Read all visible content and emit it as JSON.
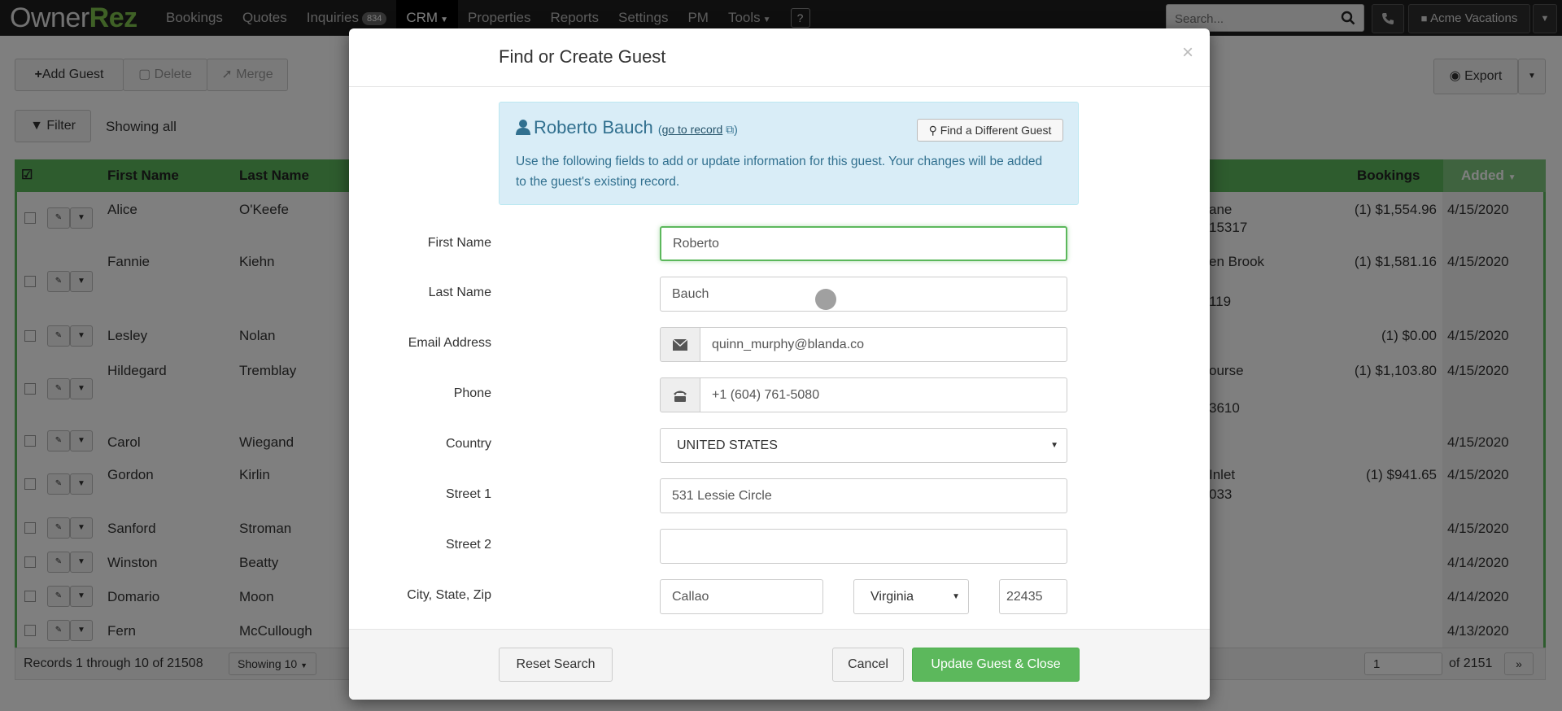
{
  "nav": {
    "logo_owner": "Owner",
    "logo_rez": "Rez",
    "items": [
      "Bookings",
      "Quotes",
      "Inquiries",
      "CRM",
      "Properties",
      "Reports",
      "Settings",
      "PM",
      "Tools",
      "?"
    ],
    "inquiries_badge": "834",
    "search_placeholder": "Search...",
    "account": "Acme Vacations"
  },
  "toolbar": {
    "add_guest": "Add Guest",
    "delete": "Delete",
    "merge": "Merge",
    "filter": "Filter",
    "showing": "Showing all",
    "export": "Export"
  },
  "grid": {
    "columns": [
      "First Name",
      "Last Name",
      "Bookings",
      "Added"
    ],
    "rows": [
      {
        "first": "Alice",
        "last": "O'Keefe",
        "addr1": "ane",
        "addr2": "15317",
        "bookings": "(1) $1,554.96",
        "added": "4/15/2020"
      },
      {
        "first": "Fannie",
        "last": "Kiehn",
        "addr1": "en Brook",
        "addr2": "119",
        "bookings": "(1) $1,581.16",
        "added": "4/15/2020"
      },
      {
        "first": "Lesley",
        "last": "Nolan",
        "addr1": "",
        "addr2": "",
        "bookings": "(1) $0.00",
        "added": "4/15/2020"
      },
      {
        "first": "Hildegard",
        "last": "Tremblay",
        "addr1": "ourse",
        "addr2": "3610",
        "bookings": "(1) $1,103.80",
        "added": "4/15/2020"
      },
      {
        "first": "Carol",
        "last": "Wiegand",
        "addr1": "",
        "addr2": "",
        "bookings": "",
        "added": "4/15/2020"
      },
      {
        "first": "Gordon",
        "last": "Kirlin",
        "addr1": "Inlet",
        "addr2": "033",
        "bookings": "(1) $941.65",
        "added": "4/15/2020"
      },
      {
        "first": "Sanford",
        "last": "Stroman",
        "addr1": "",
        "addr2": "",
        "bookings": "",
        "added": "4/15/2020"
      },
      {
        "first": "Winston",
        "last": "Beatty",
        "addr1": "",
        "addr2": "",
        "bookings": "",
        "added": "4/14/2020"
      },
      {
        "first": "Domario",
        "last": "Moon",
        "addr1": "",
        "addr2": "",
        "bookings": "",
        "added": "4/14/2020"
      },
      {
        "first": "Fern",
        "last": "McCullough",
        "addr1": "",
        "addr2": "",
        "bookings": "",
        "added": "4/13/2020"
      }
    ],
    "records": "Records 1 through 10 of 21508",
    "showing_per_page": "Showing 10",
    "page": "1",
    "of_pages": "of 2151"
  },
  "modal": {
    "title": "Find or Create Guest",
    "close": "×",
    "guest_name": "Roberto Bauch",
    "go_to_record": "go to record",
    "find_different": "Find a Different Guest",
    "info_text": "Use the following fields to add or update information for this guest. Your changes will be added to the guest's existing record.",
    "labels": {
      "first_name": "First Name",
      "last_name": "Last Name",
      "email": "Email Address",
      "phone": "Phone",
      "country": "Country",
      "street1": "Street 1",
      "street2": "Street 2",
      "city_state_zip": "City, State, Zip"
    },
    "values": {
      "first_name": "Roberto",
      "last_name": "Bauch",
      "email": "quinn_murphy@blanda.co",
      "phone": "+1 (604) 761-5080",
      "country": "UNITED STATES",
      "street1": "531 Lessie Circle",
      "street2": "",
      "city": "Callao",
      "state": "Virginia",
      "zip": "22435"
    },
    "reset_search": "Reset Search",
    "cancel": "Cancel",
    "update_close": "Update Guest & Close"
  },
  "colors": {
    "brand_green": "#5cb85c",
    "info_blue": "#31708f"
  }
}
